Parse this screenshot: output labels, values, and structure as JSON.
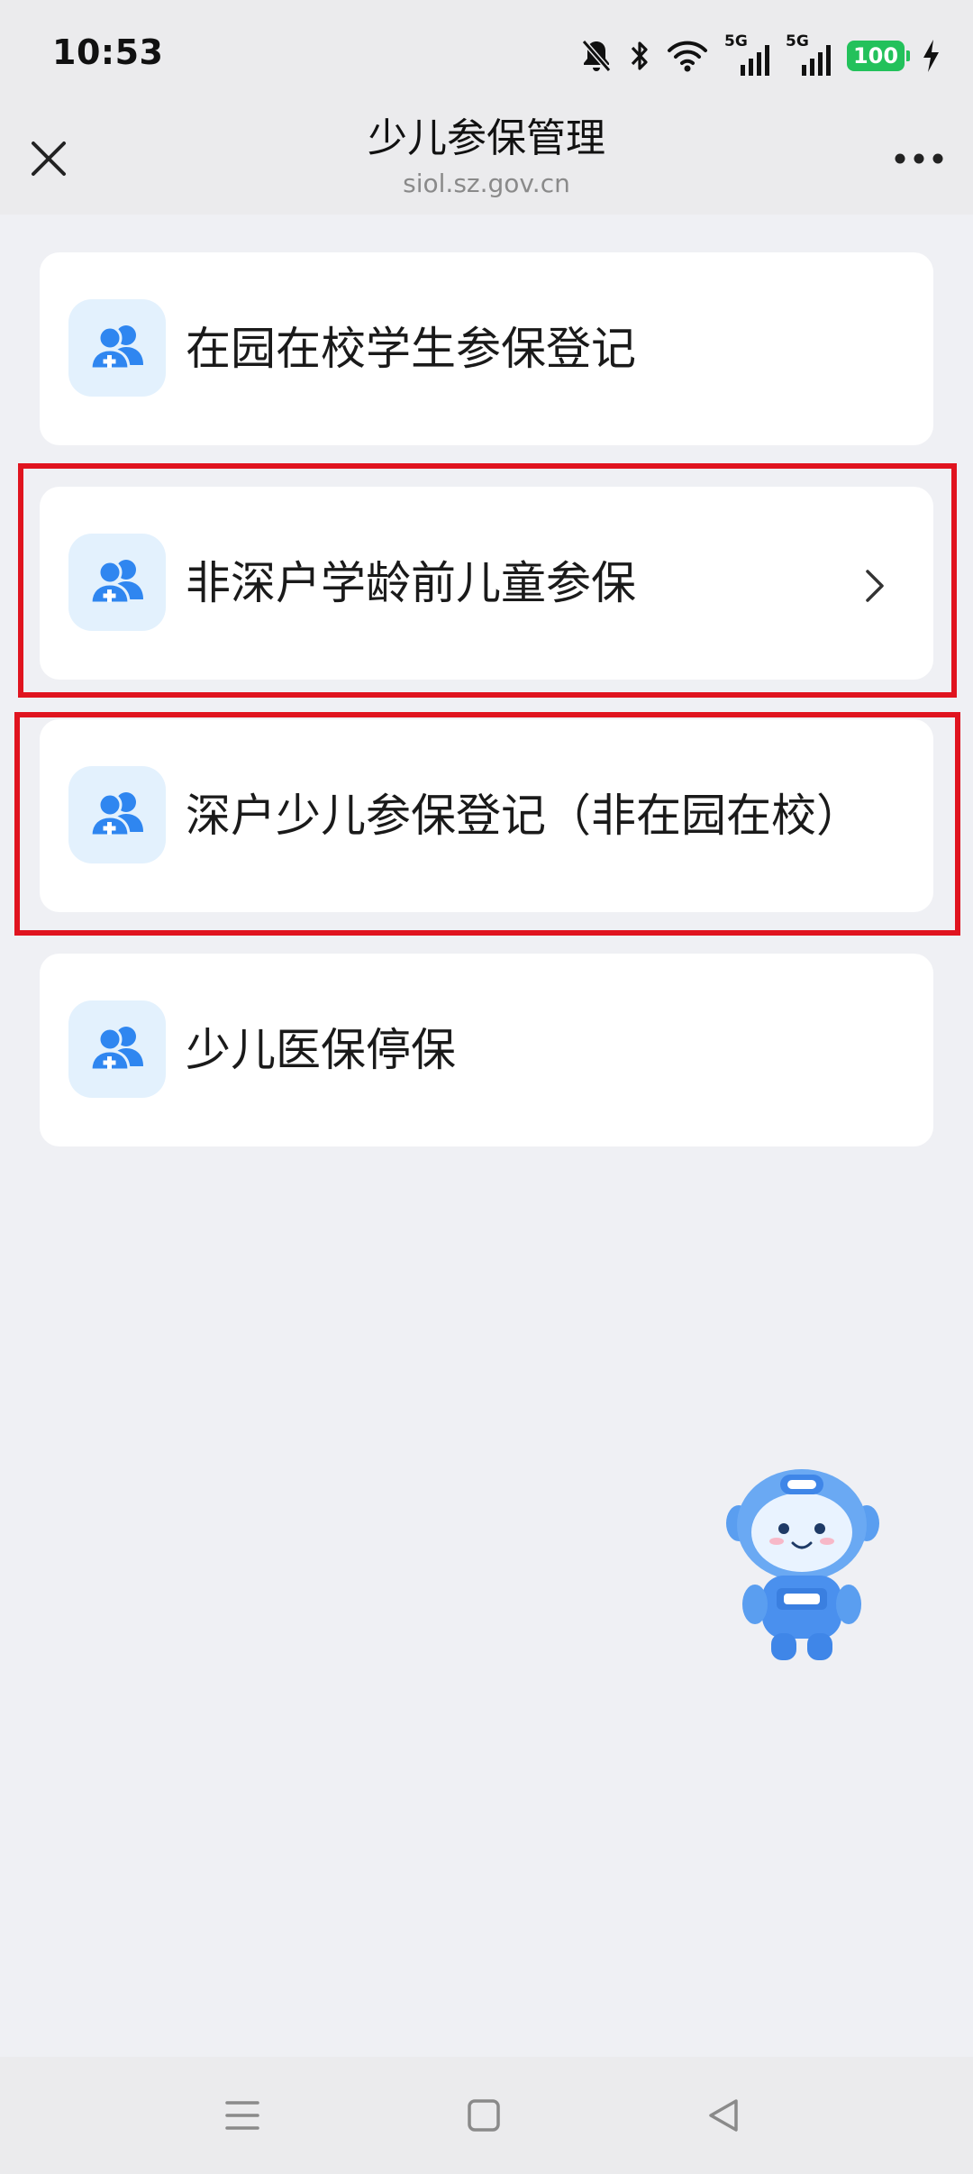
{
  "status_bar": {
    "time": "10:53",
    "network_1": "5G",
    "network_2": "5G",
    "battery": "100",
    "icons": [
      "mute-bell-icon",
      "bluetooth-icon",
      "wifi-icon",
      "signal-icon",
      "signal-icon",
      "battery-icon",
      "charging-icon"
    ]
  },
  "header": {
    "title": "少儿参保管理",
    "subtitle": "siol.sz.gov.cn",
    "close_icon": "close-icon",
    "more_icon": "more-dots-icon"
  },
  "menu": {
    "items": [
      {
        "label": "在园在校学生参保登记",
        "icon": "people-plus-icon",
        "highlighted": false
      },
      {
        "label": "非深户学龄前儿童参保",
        "icon": "people-plus-icon",
        "highlighted": true,
        "chevron": true
      },
      {
        "label": "深户少儿参保登记（非在园在校）",
        "icon": "people-plus-icon",
        "highlighted": true
      },
      {
        "label": "少儿医保停保",
        "icon": "people-plus-icon",
        "highlighted": false
      }
    ]
  },
  "colors": {
    "accent_blue": "#2f86f0",
    "icon_bg": "#e3f1fd",
    "highlight_red": "#e0141f",
    "page_bg": "#eff0f4",
    "battery_green": "#23c15b"
  },
  "mascot": {
    "icon": "assistant-robot-mascot"
  },
  "nav_bar": {
    "icons": [
      "menu-lines-icon",
      "home-square-icon",
      "back-triangle-icon"
    ]
  }
}
